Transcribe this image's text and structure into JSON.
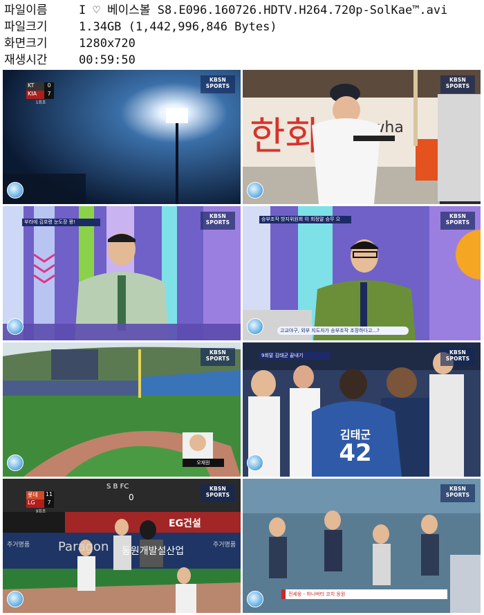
{
  "info": {
    "rows": [
      {
        "key": "파일이름",
        "value": "I ♡ 베이스볼 S8.E096.160726.HDTV.H264.720p-SolKae™.avi"
      },
      {
        "key": "파일크기",
        "value": "1.34GB (1,442,996,846 Bytes)"
      },
      {
        "key": "화면크기",
        "value": "1280x720"
      },
      {
        "key": "재생시간",
        "value": "00:59:50"
      }
    ]
  },
  "broadcast": {
    "channel_bug": "KBSN SPORTS"
  },
  "thumbs": [
    {
      "score": {
        "team1": "KT",
        "runs1": "0",
        "team2": "KIA",
        "runs2": "7",
        "inning": "1회초"
      }
    },
    {
      "sign_text": "한화",
      "wall_text": "anwha"
    },
    {
      "caption": "부라에 김호령 눈도장 꽝!"
    },
    {
      "caption": "승부조작 방지위원회 이 회정말 승무 으",
      "subtitle": "고교야구, 외부 지도자가 승부조작 조장하다고...?"
    },
    {
      "scoreboard_name": "오재원"
    },
    {
      "caption": "9회말 김태군 끝내기",
      "jersey_name": "김태군",
      "jersey_number": "42"
    },
    {
      "score": {
        "team1": "롯데",
        "runs1": "11",
        "team2": "LG",
        "runs2": "7",
        "inning": "9회초"
      },
      "ad1": "EG건설",
      "ad2": "Paragon",
      "ad3": "동원개발설산업",
      "ad4": "주거명품",
      "ad5": "주거명품",
      "board": "S  B  FC",
      "board_num": "0"
    },
    {
      "caption": "전세웅 - 허니버터 코치 응원"
    }
  ]
}
